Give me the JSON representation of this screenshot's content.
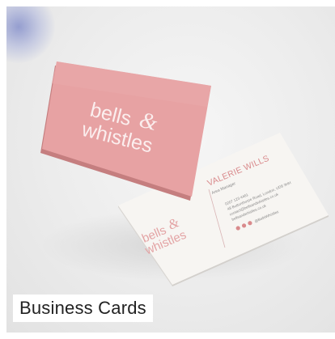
{
  "caption": "Business Cards",
  "front_card": {
    "logo_line1": "bells",
    "logo_amp": "&",
    "logo_line2": "whistles",
    "color": "#e59e9f"
  },
  "back_card": {
    "name": "VALERIE WILLS",
    "role": "Area Manager",
    "phone": "0207 123 4461",
    "address": "48 Buttonthorpe Road, London, UD8 3HH",
    "email": "contact@bellsandwhistles.co.uk",
    "website": "bellsandwhistles.co.uk",
    "social_handle": "@BellsWhistles",
    "logo_line1": "bells",
    "logo_amp": "&",
    "logo_line2": "whistles",
    "accent": "#d98a8c"
  }
}
